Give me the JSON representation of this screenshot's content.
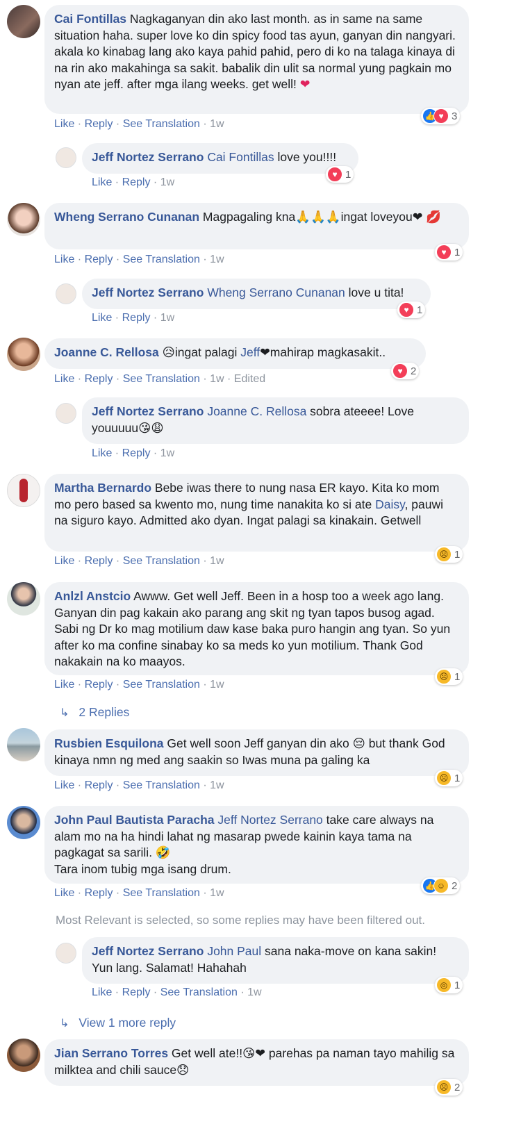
{
  "comments": [
    {
      "name": "Cai Fontillas",
      "text": "Nagkaganyan din ako last month. as in same na same situation haha. super love ko din spicy food tas ayun, ganyan din nangyari. akala ko kinabag lang ako kaya pahid pahid, pero di ko na talaga kinaya di na rin ako makahinga sa sakit. babalik din ulit sa normal yung pagkain mo nyan ate jeff. after mga ilang weeks. get well! ",
      "emoji_tail": "❤",
      "actions": [
        "Like",
        "Reply",
        "See Translation"
      ],
      "time": "1w",
      "reactions": [
        "like",
        "love"
      ],
      "reaction_count": "3",
      "reply": {
        "name": "Jeff Nortez Serrano",
        "mention": "Cai Fontillas",
        "text": " love you!!!!",
        "actions": [
          "Like",
          "Reply"
        ],
        "time": "1w",
        "reactions": [
          "love"
        ],
        "reaction_count": "1"
      }
    },
    {
      "name": "Wheng Serrano Cunanan",
      "text": "Magpagaling kna🙏🙏🙏ingat loveyou❤ 💋",
      "actions": [
        "Like",
        "Reply",
        "See Translation"
      ],
      "time": "1w",
      "reactions": [
        "love"
      ],
      "reaction_count": "1",
      "reply": {
        "name": "Jeff Nortez Serrano",
        "mention": "Wheng Serrano Cunanan",
        "text": " love u tita!",
        "actions": [
          "Like",
          "Reply"
        ],
        "time": "1w",
        "reactions": [
          "love"
        ],
        "reaction_count": "1"
      }
    },
    {
      "name": "Joanne C. Rellosa",
      "text_before": "😥ingat palagi ",
      "mention": "Jeff",
      "text_after": "❤mahirap magkasakit..",
      "actions": [
        "Like",
        "Reply",
        "See Translation"
      ],
      "time": "1w",
      "edited": "Edited",
      "reactions": [
        "love"
      ],
      "reaction_count": "2",
      "reply": {
        "name": "Jeff Nortez Serrano",
        "mention": "Joanne C. Rellosa",
        "text": " sobra ateeee! Love youuuuu😘😩",
        "actions": [
          "Like",
          "Reply"
        ],
        "time": "1w"
      }
    },
    {
      "name": "Martha Bernardo",
      "text_before": "Bebe iwas there to nung nasa ER kayo. Kita ko mom mo pero based sa kwento mo, nung time nanakita ko si ate ",
      "mention": "Daisy",
      "text_after": ", pauwi na siguro kayo. Admitted ako dyan. Ingat palagi sa kinakain. Getwell",
      "actions": [
        "Like",
        "Reply",
        "See Translation"
      ],
      "time": "1w",
      "reactions": [
        "sad"
      ],
      "reaction_count": "1"
    },
    {
      "name": "Anlzl Anstcio",
      "text": "Awww. Get well Jeff. Been in a hosp too a week ago lang. Ganyan din pag kakain ako parang ang skit ng tyan tapos busog agad. Sabi ng Dr ko mag motilium daw kase baka puro hangin ang tyan. So yun after ko ma confine sinabay ko sa meds ko yun motilium. Thank God nakakain na ko maayos.",
      "actions": [
        "Like",
        "Reply",
        "See Translation"
      ],
      "time": "1w",
      "reactions": [
        "sad"
      ],
      "reaction_count": "1",
      "more_replies": "2 Replies"
    },
    {
      "name": "Rusbien Esquilona",
      "text": "Get well soon Jeff ganyan din ako 😔 but thank God kinaya nmn ng med ang saakin so Iwas muna pa galing ka",
      "actions": [
        "Like",
        "Reply",
        "See Translation"
      ],
      "time": "1w",
      "reactions": [
        "sad"
      ],
      "reaction_count": "1"
    },
    {
      "name": "John Paul Bautista Paracha",
      "mention": "Jeff Nortez Serrano",
      "text": " take care always na alam mo na ha hindi lahat ng masarap pwede kainin kaya tama na pagkagat sa sarili. 🤣\nTara inom tubig mga isang drum.",
      "actions": [
        "Like",
        "Reply",
        "See Translation"
      ],
      "time": "1w",
      "reactions": [
        "like",
        "haha"
      ],
      "reaction_count": "2",
      "filter_note": "Most Relevant is selected, so some replies may have been filtered out.",
      "reply": {
        "name": "Jeff Nortez Serrano",
        "mention": "John Paul",
        "text": " sana naka-move on kana sakin! Yun lang. Salamat! Hahahah",
        "actions": [
          "Like",
          "Reply",
          "See Translation"
        ],
        "time": "1w",
        "reactions": [
          "wow"
        ],
        "reaction_count": "1"
      },
      "more_replies": "View 1 more reply"
    },
    {
      "name": "Jian Serrano Torres",
      "text": "Get well ate!!😘❤ parehas pa naman tayo mahilig sa milktea and chili sauce😞",
      "reaction_count": "2"
    }
  ],
  "colors": {
    "name": "#385898",
    "bubble": "#f0f2f5",
    "meta": "#8d949e"
  }
}
